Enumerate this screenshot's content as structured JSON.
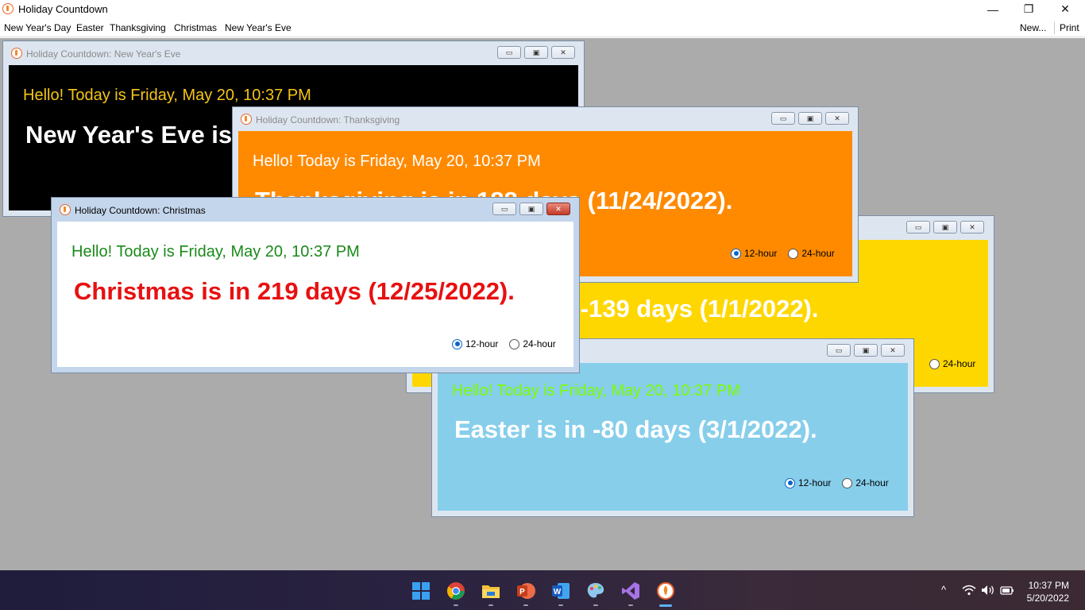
{
  "app": {
    "title": "Holiday Countdown",
    "controls": {
      "minimize": "—",
      "restore": "❐",
      "close": "✕"
    }
  },
  "menu": {
    "items": [
      "New Year's Day",
      "Easter",
      "Thanksgiving",
      "Christmas",
      "New Year's Eve"
    ],
    "right_items": [
      "New...",
      "Print"
    ]
  },
  "child_buttons": {
    "minimize": "▭",
    "restore": "▣",
    "close": "✕"
  },
  "windows": {
    "new_years_eve": {
      "title": "Holiday Countdown: New Year's Eve",
      "greeting": "Hello! Today is Friday, May 20, 10:37 PM",
      "countdown": "New Year's Eve is",
      "bg": "#000000",
      "greeting_color": "#f5c518",
      "countdown_color": "#ffffff"
    },
    "thanksgiving": {
      "title": "Holiday Countdown: Thanksgiving",
      "greeting": "Hello! Today is Friday, May 20, 10:37 PM",
      "countdown": "Thanksgiving is in 188 days (11/24/2022).",
      "bg": "#ff8a00",
      "greeting_color": "#ffffff",
      "countdown_color": "#ffffff",
      "radio_12": "12-hour",
      "radio_24": "24-hour",
      "selected": "12-hour"
    },
    "new_years_day": {
      "countdown": "New Year's Day is in -139 days (1/1/2022).",
      "bg": "#ffd700",
      "countdown_color": "#ffffff",
      "radio_24": "24-hour"
    },
    "easter": {
      "greeting": "Hello! Today is Friday, May 20, 10:37 PM",
      "countdown": "Easter is in -80 days (3/1/2022).",
      "bg": "#87ceeb",
      "greeting_color": "#7cfc00",
      "countdown_color": "#ffffff",
      "radio_12": "12-hour",
      "radio_24": "24-hour",
      "selected": "12-hour"
    },
    "christmas": {
      "title": "Holiday Countdown: Christmas",
      "greeting": "Hello! Today is Friday, May 20, 10:37 PM",
      "countdown": "Christmas is in 219 days (12/25/2022).",
      "bg": "#ffffff",
      "greeting_color": "#1a8a1a",
      "countdown_color": "#e81010",
      "radio_12": "12-hour",
      "radio_24": "24-hour",
      "selected": "12-hour"
    }
  },
  "taskbar": {
    "apps": [
      "start-icon",
      "chrome-icon",
      "file-explorer-icon",
      "powerpoint-icon",
      "word-icon",
      "paint-icon",
      "visual-studio-icon",
      "holiday-countdown-icon"
    ],
    "tray_chevron": "^",
    "time": "10:37 PM",
    "date": "5/20/2022"
  }
}
